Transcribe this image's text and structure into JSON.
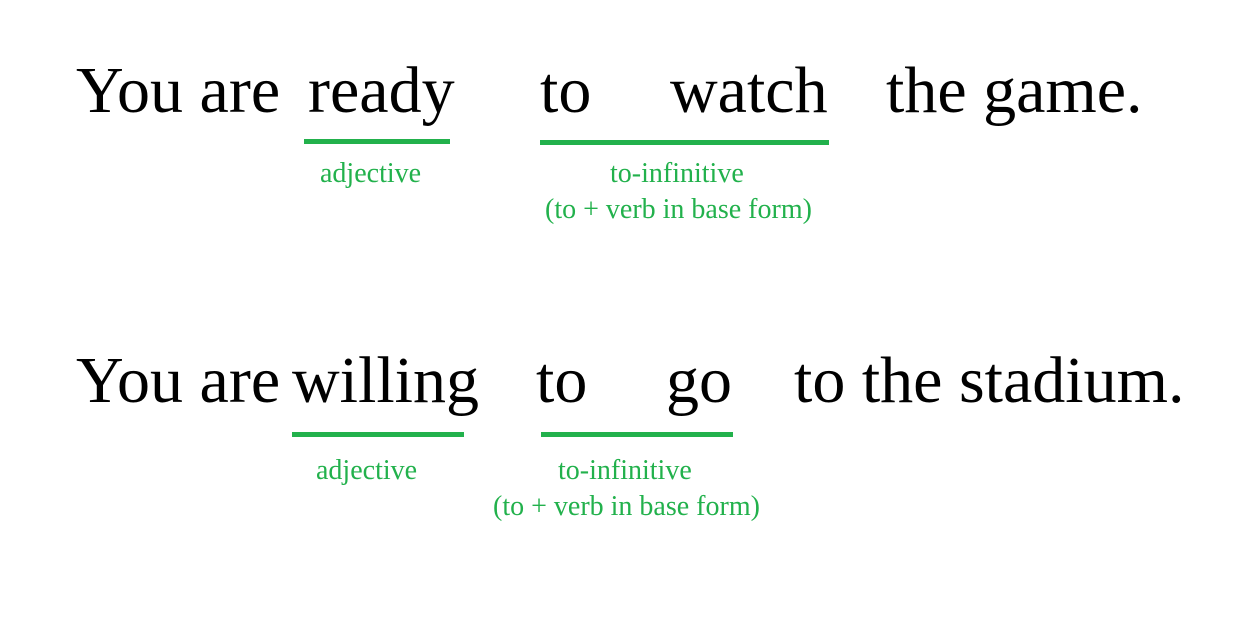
{
  "accent_color": "#22b14c",
  "sentences": [
    {
      "words": {
        "prefix": "You are",
        "adjective": "ready",
        "to": "to",
        "verb": "watch",
        "suffix": "the game."
      },
      "labels": {
        "adjective": "adjective",
        "infinitive": "to-infinitive",
        "infinitive_note": "(to + verb in base form)"
      }
    },
    {
      "words": {
        "prefix": "You are",
        "adjective": "willing",
        "to": "to",
        "verb": "go",
        "suffix": "to the stadium."
      },
      "labels": {
        "adjective": "adjective",
        "infinitive": "to-infinitive",
        "infinitive_note": "(to + verb in base form)"
      }
    }
  ]
}
